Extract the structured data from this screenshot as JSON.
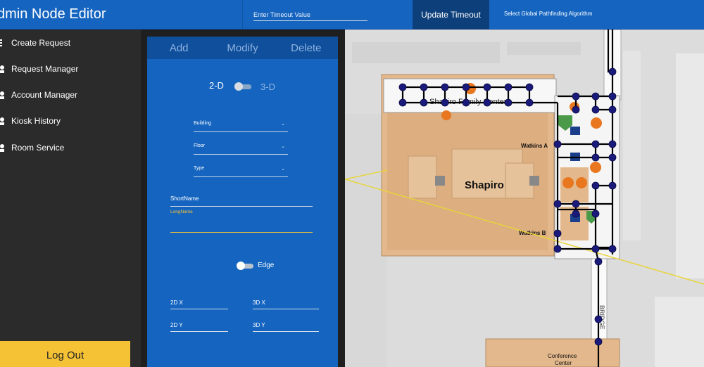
{
  "app": {
    "title": "dmin Node Editor"
  },
  "topbar": {
    "timeout_placeholder": "Enter Timeout Value",
    "update_button": "Update Timeout",
    "algorithm_label": "Select Global Pathfinding Algorithm"
  },
  "sidebar": {
    "items": [
      {
        "label": "Create Request",
        "icon": "list-icon"
      },
      {
        "label": "Request Manager",
        "icon": "person-icon"
      },
      {
        "label": "Account Manager",
        "icon": "person-icon"
      },
      {
        "label": "Kiosk History",
        "icon": "person-icon"
      },
      {
        "label": "Room Service",
        "icon": "person-icon"
      }
    ],
    "logout": "Log Out"
  },
  "editor": {
    "tabs": [
      "Add",
      "Modify",
      "Delete"
    ],
    "dim_2d": "2-D",
    "dim_3d": "3-D",
    "building_label": "Building",
    "floor_label": "Floor",
    "type_label": "Type",
    "shortname_label": "ShortName",
    "longname_label": "LongName",
    "edge_label": "Edge",
    "x2d_label": "2D X",
    "x3d_label": "3D X",
    "y2d_label": "2D Y",
    "y3d_label": "3D Y"
  },
  "map": {
    "labels": {
      "family_center": "Shapiro Family Center",
      "building": "Shapiro",
      "watkins_a": "Watkins A",
      "watkins_b": "Watkins B",
      "bridge": "BRIDGE",
      "conference_1": "Conference",
      "conference_2": "Center"
    },
    "colors": {
      "node": "#1a1a7a",
      "edge": "#000000",
      "path_line": "#e8d53a",
      "building": "#e3b88c",
      "service_icon": "#e8771f",
      "accent_green": "#4a9a4a"
    }
  }
}
